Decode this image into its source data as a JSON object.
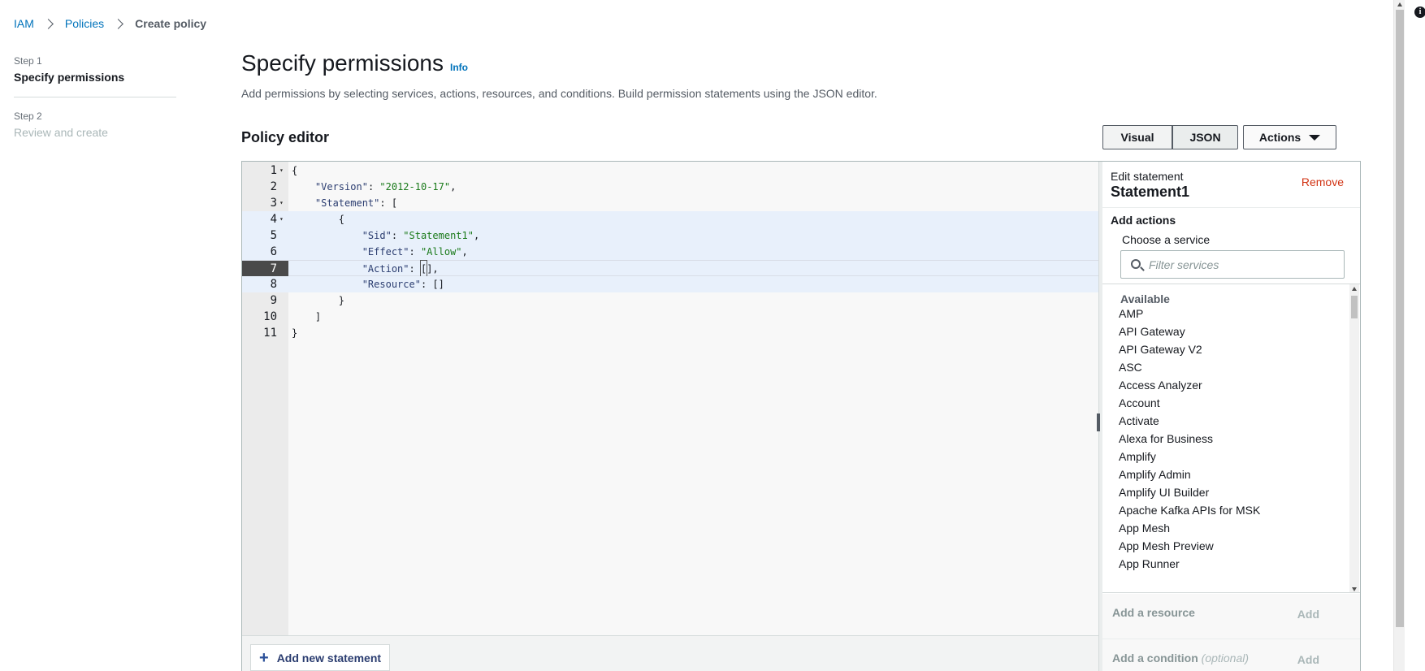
{
  "breadcrumb": {
    "items": [
      "IAM",
      "Policies"
    ],
    "current": "Create policy"
  },
  "steps": [
    {
      "label": "Step 1",
      "title": "Specify permissions"
    },
    {
      "label": "Step 2",
      "title": "Review and create"
    }
  ],
  "header": {
    "title": "Specify permissions",
    "info": "Info",
    "description": "Add permissions by selecting services, actions, resources, and conditions. Build permission statements using the JSON editor."
  },
  "editor": {
    "section_title": "Policy editor",
    "mode_visual": "Visual",
    "mode_json": "JSON",
    "actions_label": "Actions",
    "active_mode": "JSON",
    "line_numbers": [
      "1",
      "2",
      "3",
      "4",
      "5",
      "6",
      "7",
      "8",
      "9",
      "10",
      "11"
    ],
    "active_line": "7",
    "add_statement_label": "Add new statement"
  },
  "panel": {
    "edit_label": "Edit statement",
    "statement_name": "Statement1",
    "remove_label": "Remove",
    "add_actions_label": "Add actions",
    "choose_service_label": "Choose a service",
    "filter_placeholder": "Filter services",
    "available_label": "Available",
    "services": [
      "AMP",
      "API Gateway",
      "API Gateway V2",
      "ASC",
      "Access Analyzer",
      "Account",
      "Activate",
      "Alexa for Business",
      "Amplify",
      "Amplify Admin",
      "Amplify UI Builder",
      "Apache Kafka APIs for MSK",
      "App Mesh",
      "App Mesh Preview",
      "App Runner"
    ],
    "add_resource_label": "Add a resource",
    "add_condition_label": "Add a condition",
    "optional_label": "(optional)",
    "add_label": "Add"
  },
  "colors": {
    "link": "#0073bb",
    "remove": "#d13212",
    "string": "#1a7a1a"
  },
  "icons": [
    "chevron-right-icon",
    "caret-down-icon",
    "search-icon",
    "plus-icon",
    "info-icon"
  ]
}
